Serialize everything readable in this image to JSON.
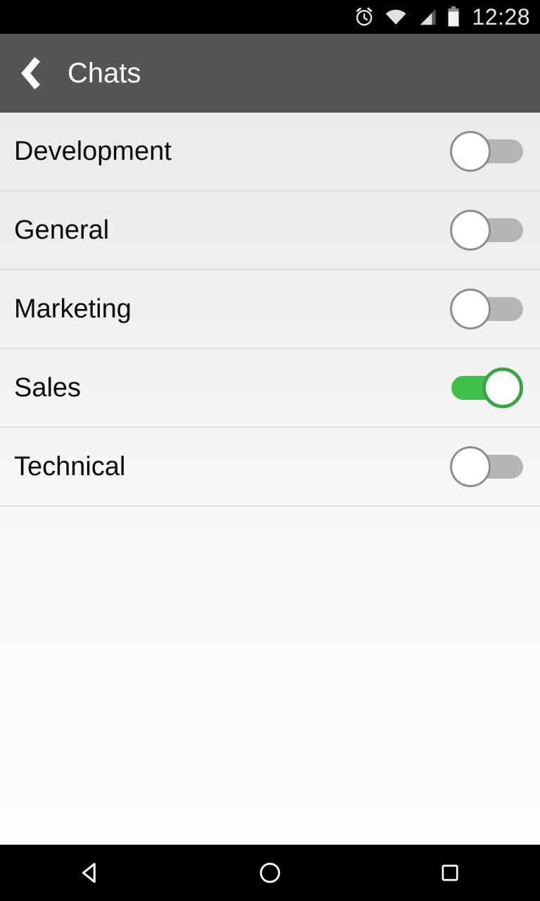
{
  "status_bar": {
    "time": "12:28",
    "icons": [
      "alarm-icon",
      "wifi-icon",
      "signal-icon",
      "battery-icon"
    ]
  },
  "header": {
    "title": "Chats",
    "back_icon": "chevron-left-icon",
    "background_color": "#555557"
  },
  "list": {
    "rows": [
      {
        "label": "Development",
        "enabled": false
      },
      {
        "label": "General",
        "enabled": false
      },
      {
        "label": "Marketing",
        "enabled": false
      },
      {
        "label": "Sales",
        "enabled": true
      },
      {
        "label": "Technical",
        "enabled": false
      }
    ]
  },
  "colors": {
    "switch_on_track": "#3fc14b",
    "switch_on_ring": "#3aa548",
    "switch_off_track": "#b5b5b5",
    "switch_off_ring": "#8d8d8d"
  },
  "nav_bar": {
    "back_label": "back-button",
    "home_label": "home-button",
    "recents_label": "recents-button"
  }
}
